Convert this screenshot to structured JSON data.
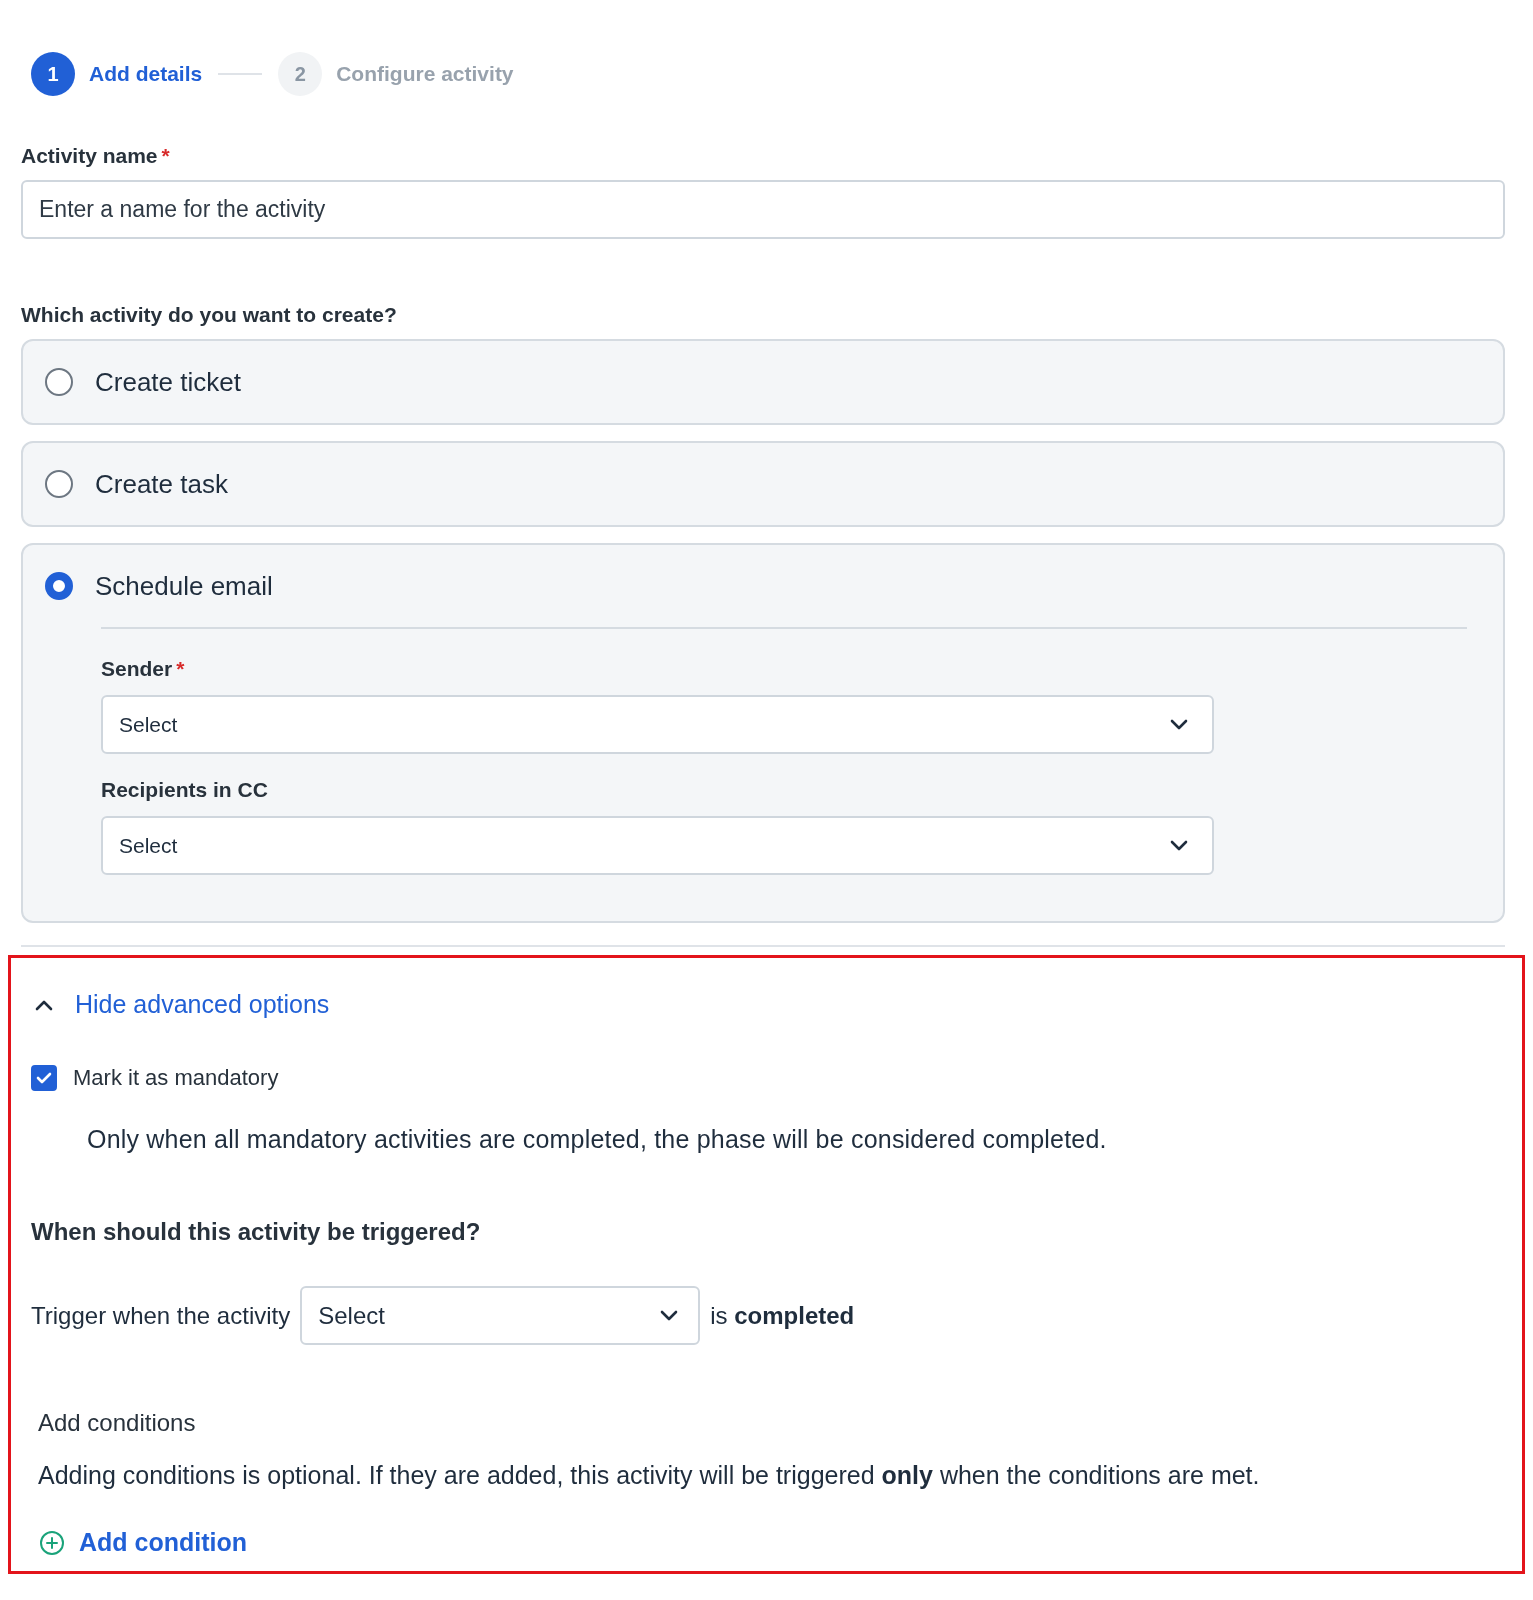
{
  "stepper": {
    "steps": [
      {
        "number": "1",
        "label": "Add details",
        "selected": true
      },
      {
        "number": "2",
        "label": "Configure activity",
        "selected": false
      }
    ]
  },
  "activity_name": {
    "label": "Activity name",
    "required_mark": "*",
    "placeholder": "Enter a name for the activity"
  },
  "activity_type": {
    "question": "Which activity do you want to create?",
    "options": [
      {
        "label": "Create ticket",
        "selected": false
      },
      {
        "label": "Create task",
        "selected": false
      },
      {
        "label": "Schedule email",
        "selected": true,
        "fields": [
          {
            "label": "Sender",
            "required_mark": "*",
            "value": "Select"
          },
          {
            "label": "Recipients in CC",
            "value": "Select"
          }
        ]
      }
    ]
  },
  "advanced": {
    "toggle": "Hide advanced options",
    "expanded": true,
    "mandatory": {
      "label": "Mark it as mandatory",
      "checked": true,
      "description": "Only when all mandatory activities are completed, the phase will be considered completed."
    },
    "trigger": {
      "heading": "When should this activity be triggered?",
      "prefix": "Trigger when the activity",
      "value": "Select",
      "suffix": "is **completed**"
    },
    "conditions": {
      "heading": "Add conditions",
      "description": "Adding conditions is optional. If they are added, this activity will be triggered **only** when the conditions are met.",
      "add_button": "Add condition"
    }
  }
}
